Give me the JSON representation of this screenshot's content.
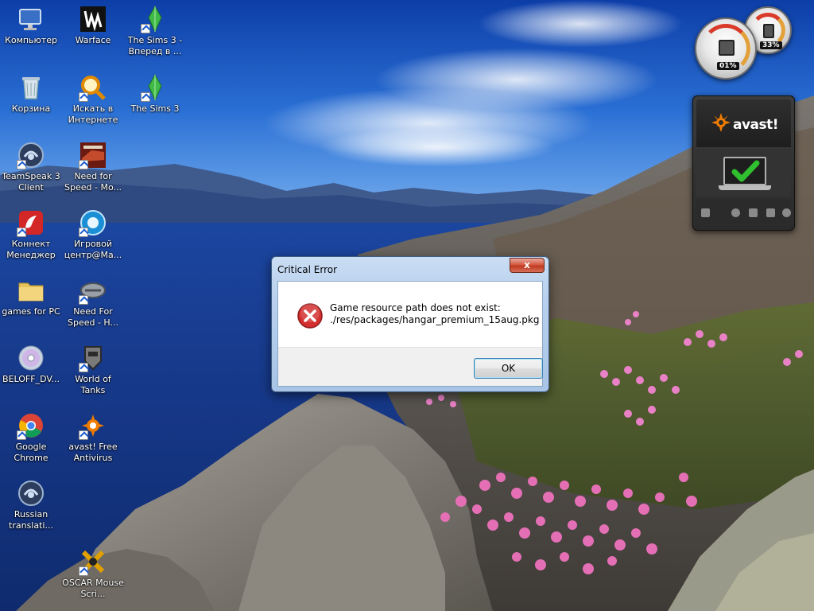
{
  "desktop_icons": [
    {
      "label": "Компьютер",
      "icon": "computer-icon",
      "shortcut": false
    },
    {
      "label": "Корзина",
      "icon": "recycle-bin-icon",
      "shortcut": false
    },
    {
      "label": "TeamSpeak 3 Client",
      "icon": "teamspeak-icon",
      "shortcut": true
    },
    {
      "label": "Коннект Менеджер",
      "icon": "connect-manager-icon",
      "shortcut": true
    },
    {
      "label": "games for PC",
      "icon": "folder-icon",
      "shortcut": false
    },
    {
      "label": "BELOFF_DV...",
      "icon": "disc-icon",
      "shortcut": false
    },
    {
      "label": "Google Chrome",
      "icon": "chrome-icon",
      "shortcut": true
    },
    {
      "label": "Russian translati...",
      "icon": "teamspeak-icon",
      "shortcut": false
    },
    {
      "label": "Warface",
      "icon": "warface-icon",
      "shortcut": false
    },
    {
      "label": "Искать в Интернете",
      "icon": "search-web-icon",
      "shortcut": true
    },
    {
      "label": "Need for Speed - Mo...",
      "icon": "nfs-most-wanted-icon",
      "shortcut": true
    },
    {
      "label": "Игровой центр@Ма...",
      "icon": "game-center-icon",
      "shortcut": true
    },
    {
      "label": "Need For Speed - H...",
      "icon": "nfs-hot-pursuit-icon",
      "shortcut": true
    },
    {
      "label": "World of Tanks",
      "icon": "world-of-tanks-icon",
      "shortcut": true
    },
    {
      "label": "avast! Free Antivirus",
      "icon": "avast-icon",
      "shortcut": true
    },
    {
      "label": "OSCAR Mouse Scri...",
      "icon": "oscar-icon",
      "shortcut": true
    },
    {
      "label": "The Sims 3 - Вперед в ...",
      "icon": "sims3-icon",
      "shortcut": true
    },
    {
      "label": "The Sims 3",
      "icon": "sims3-icon",
      "shortcut": true
    }
  ],
  "gadgets": {
    "cpu_meter": {
      "cpu_percent": "01%",
      "memory_percent": "33%"
    },
    "avast": {
      "logo_text": "avast!",
      "status": "protected",
      "accent": "#f07c00",
      "check_color": "#2fbf2f"
    }
  },
  "dialog": {
    "title": "Critical Error",
    "close_label": "x",
    "message_line1": "Game resource path does not exist:",
    "message_line2": "./res/packages/hangar_premium_15aug.pkg",
    "ok_label": "OK",
    "icon": "error-icon",
    "accent": "#d32f2f"
  }
}
